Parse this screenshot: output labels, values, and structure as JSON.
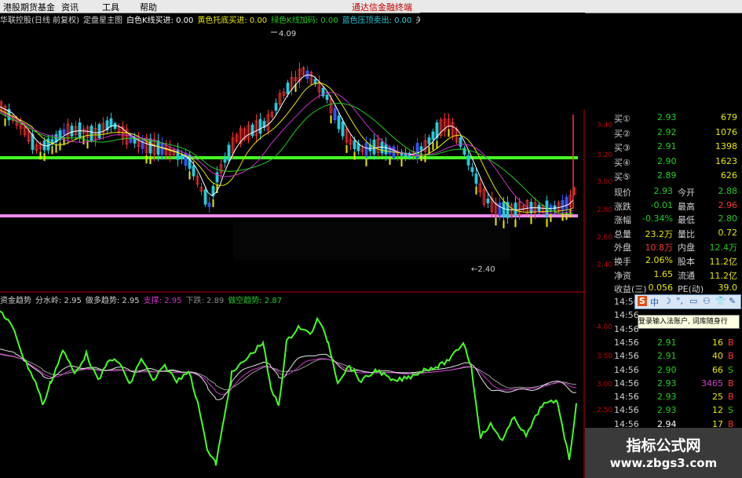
{
  "menubar": {
    "items": [
      "港股期货基金",
      "资讯",
      "工具",
      "帮助"
    ],
    "right_text": "通达信金融终端"
  },
  "main_chart": {
    "indicator_line": [
      {
        "text": "华联控股(日线 前复权)",
        "color": "#d0d0d0"
      },
      {
        "text": "定盘星主图",
        "color": "#d0d0d0"
      },
      {
        "text": "白色K线买进: 0.00",
        "color": "#ffffff"
      },
      {
        "text": "黄色托底买进: 0.00",
        "color": "#e8e800"
      },
      {
        "text": "绿色K线加码: 0.00",
        "color": "#22cc22"
      },
      {
        "text": "蓝色压顶卖出: 0.00",
        "color": "#22ccdd"
      },
      {
        "text": "关注",
        "color": "#d0d0d0"
      }
    ],
    "high_label": "4.09",
    "low_label": "←2.40",
    "axis_labels": [
      "3.40",
      "3.20",
      "3.00",
      "2.80",
      "2.60",
      "2.40"
    ]
  },
  "lower_chart": {
    "indicator_line": [
      {
        "text": "资金趋势",
        "color": "#d0d0d0"
      },
      {
        "text": "分水岭: 2.95",
        "color": "#d0d0d0"
      },
      {
        "text": "做多趋势: 2.95",
        "color": "#d0d0d0"
      },
      {
        "text": "支撑: 2.95",
        "color": "#cc33cc"
      },
      {
        "text": "下跌: 2.89",
        "color": "#888888"
      },
      {
        "text": "做空趋势: 2.87",
        "color": "#22cc22"
      }
    ],
    "axis_labels": [
      "4.00",
      "3.50",
      "3.00",
      "2.50"
    ]
  },
  "order_book": [
    {
      "label": "买①",
      "price": "2.93",
      "vol": "679"
    },
    {
      "label": "买②",
      "price": "2.92",
      "vol": "1076"
    },
    {
      "label": "买③",
      "price": "2.91",
      "vol": "1398"
    },
    {
      "label": "买④",
      "price": "2.90",
      "vol": "1623"
    },
    {
      "label": "买⑤",
      "price": "2.89",
      "vol": "626"
    }
  ],
  "quote": [
    {
      "l1": "现价",
      "v1": "2.93",
      "c1": "#22cc22",
      "l2": "今开",
      "v2": "2.88",
      "c2": "#22cc22"
    },
    {
      "l1": "涨跌",
      "v1": "-0.01",
      "c1": "#22cc22",
      "l2": "最高",
      "v2": "2.96",
      "c2": "#ff3333"
    },
    {
      "l1": "涨幅",
      "v1": "-0.34%",
      "c1": "#22cc22",
      "l2": "最低",
      "v2": "2.80",
      "c2": "#22cc22"
    },
    {
      "l1": "总量",
      "v1": "23.2万",
      "c1": "#e8e800",
      "l2": "量比",
      "v2": "0.72",
      "c2": "#e8e800"
    },
    {
      "l1": "外盘",
      "v1": "10.8万",
      "c1": "#ff3333",
      "l2": "内盘",
      "v2": "12.4万",
      "c2": "#22cc22"
    },
    {
      "l1": "换手",
      "v1": "2.06%",
      "c1": "#e8e800",
      "l2": "股本",
      "v2": "11.2亿",
      "c2": "#e8e800"
    },
    {
      "l1": "净资",
      "v1": "1.65",
      "c1": "#e8e800",
      "l2": "流通",
      "v2": "11.2亿",
      "c2": "#e8e800"
    },
    {
      "l1": "收益(三)",
      "v1": "0.056",
      "c1": "#e8e800",
      "l2": "PE(动)",
      "v2": "39.0",
      "c2": "#e8e800"
    }
  ],
  "ticks": [
    {
      "time": "14:56",
      "price": "",
      "vol": "",
      "side": ""
    },
    {
      "time": "14:56",
      "price": "",
      "vol": "",
      "side": ""
    },
    {
      "time": "14:56",
      "price": "",
      "vol": "",
      "side": ""
    },
    {
      "time": "14:56",
      "price": "2.91",
      "vol": "16",
      "side": "B"
    },
    {
      "time": "14:56",
      "price": "2.91",
      "vol": "40",
      "side": "B"
    },
    {
      "time": "14:56",
      "price": "2.90",
      "vol": "66",
      "side": "S"
    },
    {
      "time": "14:56",
      "price": "2.93",
      "vol": "3465",
      "side": "B"
    },
    {
      "time": "14:56",
      "price": "2.93",
      "vol": "25",
      "side": "B"
    },
    {
      "time": "14:56",
      "price": "2.93",
      "vol": "12",
      "side": "S"
    },
    {
      "time": "14:56",
      "price": "2.94",
      "vol": "17",
      "side": "B"
    },
    {
      "time": "14:56",
      "price": "",
      "vol": "",
      "side": ""
    }
  ],
  "ime": {
    "items": [
      "S",
      "中",
      "☽",
      "°,",
      "▭",
      "⚇",
      "👕",
      "✎"
    ],
    "tip": "登录输入法账户, 词库随身行"
  },
  "logo": {
    "title": "指标公式网",
    "url": "www.zbgs3.com"
  }
}
